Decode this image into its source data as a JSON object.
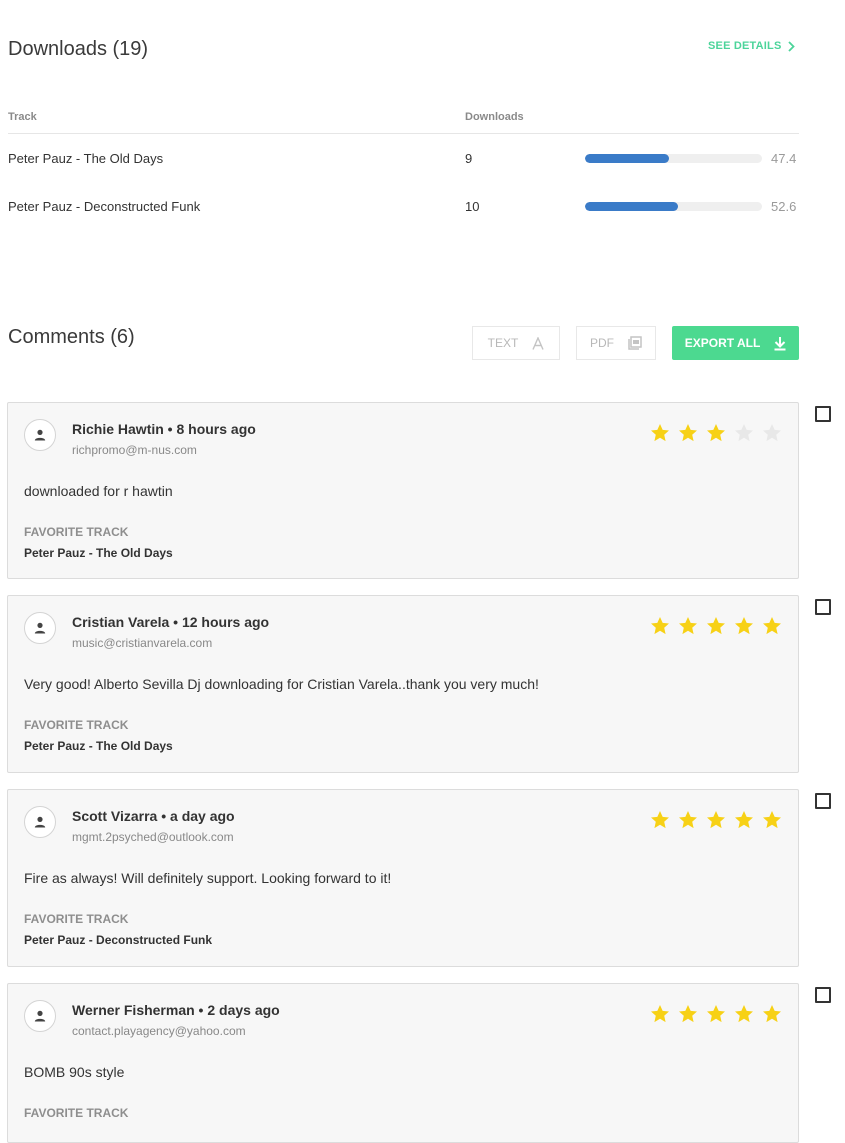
{
  "downloads": {
    "title": "Downloads (19)",
    "see_details": "SEE DETAILS",
    "columns": {
      "track": "Track",
      "downloads": "Downloads"
    },
    "rows": [
      {
        "track": "Peter Pauz - The Old Days",
        "count": "9",
        "percent": "47.4",
        "fill": 0.474
      },
      {
        "track": "Peter Pauz - Deconstructed Funk",
        "count": "10",
        "percent": "52.6",
        "fill": 0.526
      }
    ]
  },
  "comments": {
    "title": "Comments (6)",
    "buttons": {
      "text": "TEXT",
      "pdf": "PDF",
      "export": "EXPORT ALL"
    },
    "items": [
      {
        "header": "Richie Hawtin • 8 hours ago",
        "email": "richpromo@m-nus.com",
        "rating": 3,
        "body": "downloaded for r hawtin",
        "favorite_label": "FAVORITE TRACK",
        "favorite_track": "Peter Pauz - The Old Days"
      },
      {
        "header": "Cristian Varela • 12 hours ago",
        "email": "music@cristianvarela.com",
        "rating": 5,
        "body": "Very good! Alberto Sevilla Dj downloading for Cristian Varela..thank you very much!",
        "favorite_label": "FAVORITE TRACK",
        "favorite_track": "Peter Pauz - The Old Days"
      },
      {
        "header": "Scott Vizarra • a day ago",
        "email": "mgmt.2psyched@outlook.com",
        "rating": 5,
        "body": "Fire as always! Will definitely support. Looking forward to it!",
        "favorite_label": "FAVORITE TRACK",
        "favorite_track": "Peter Pauz - Deconstructed Funk"
      },
      {
        "header": "Werner Fisherman • 2 days ago",
        "email": "contact.playagency@yahoo.com",
        "rating": 5,
        "body": "BOMB 90s style",
        "favorite_label": "FAVORITE TRACK",
        "favorite_track": ""
      }
    ]
  },
  "icons": {
    "see_details": "chevron-right-icon",
    "text": "font-a-icon",
    "pdf": "pdf-icon",
    "export": "download-icon",
    "avatar": "person-icon",
    "star": "star-icon",
    "checkbox": "checkbox-icon"
  },
  "colors": {
    "accent": "#4cd990",
    "bar": "#3a7bc8",
    "star_on": "#f7d116",
    "star_off": "#e8e8e8"
  }
}
